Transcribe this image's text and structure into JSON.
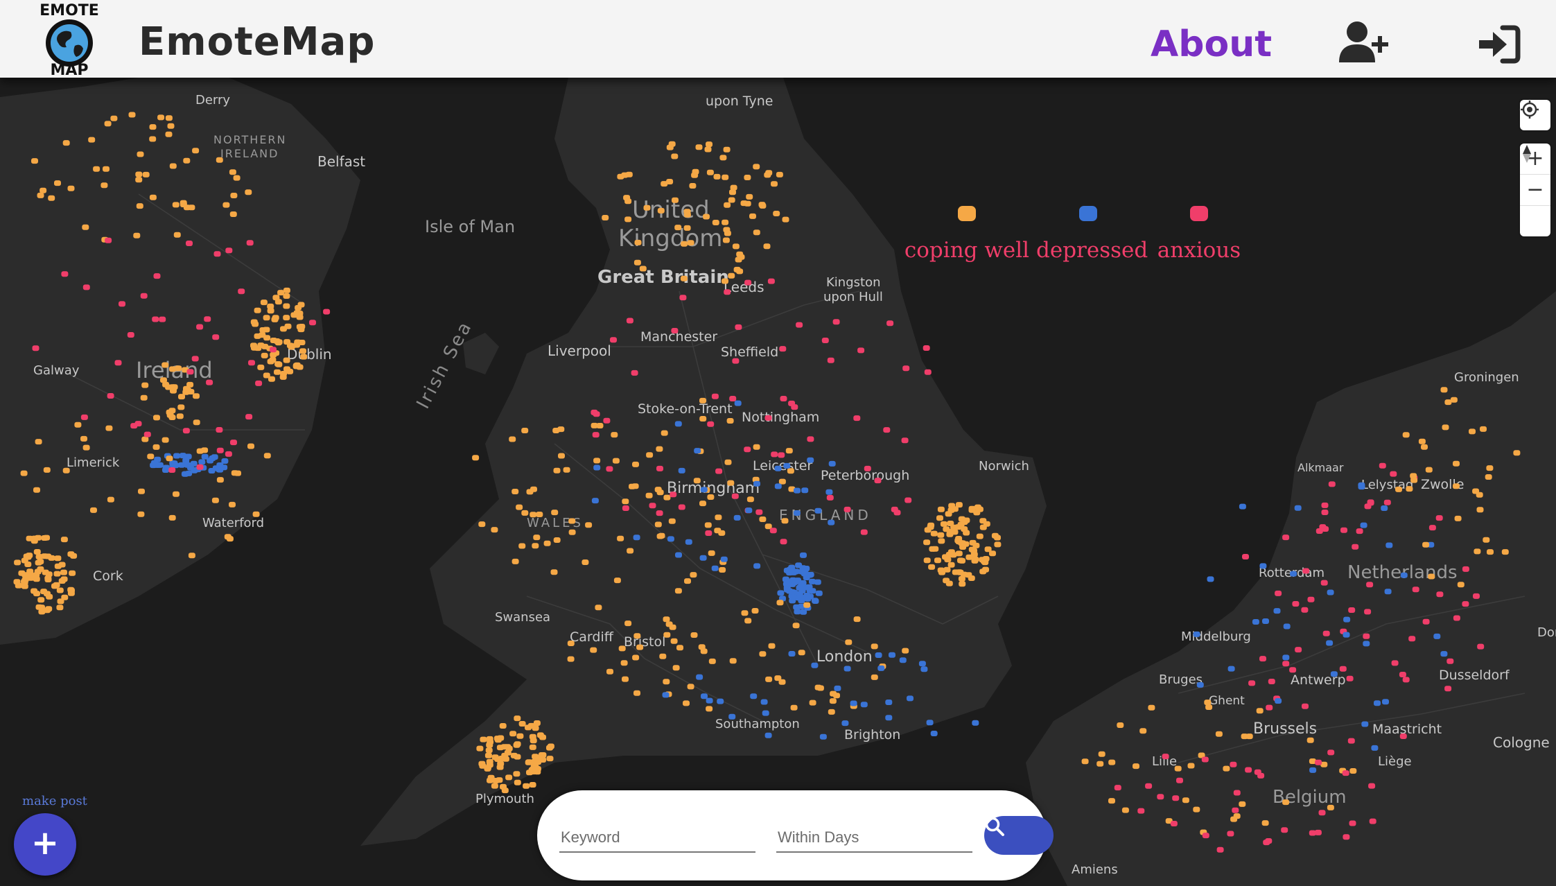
{
  "header": {
    "logo_alt": "EMOTE MAP",
    "logo_top": "EMOTE",
    "logo_bottom": "MAP",
    "brand": "EmoteMap",
    "about_label": "About",
    "signup_icon": "user-plus-icon",
    "login_icon": "sign-in-icon"
  },
  "legend": [
    {
      "label": "coping well",
      "color": "#f5a846"
    },
    {
      "label": "depressed",
      "color": "#3a74d6"
    },
    {
      "label": "anxious",
      "color": "#f03e6a"
    }
  ],
  "map_controls": {
    "locate_icon": "crosshair-icon",
    "zoom_in": "+",
    "zoom_out": "−",
    "compass_icon": "compass-icon"
  },
  "map": {
    "labels": {
      "derry": "Derry",
      "upon_tyne": "upon Tyne",
      "northern": "NORTHERN",
      "ireland_ni": "IRELAND",
      "belfast": "Belfast",
      "isle_of_man": "Isle of Man",
      "united": "United",
      "kingdom": "Kingdom",
      "great_britain": "Great Britain",
      "leeds": "Leeds",
      "kingston": "Kingston",
      "upon_hull": "upon Hull",
      "dublin": "Dublin",
      "irish_sea": "Irish Sea",
      "liverpool": "Liverpool",
      "manchester": "Manchester",
      "sheffield": "Sheffield",
      "galway": "Galway",
      "ireland": "Ireland",
      "stoke": "Stoke-on-Trent",
      "nottingham": "Nottingham",
      "limerick": "Limerick",
      "leicester": "Leicester",
      "peterborough": "Peterborough",
      "norwich": "Norwich",
      "birmingham": "Birmingham",
      "england": "ENGLAND",
      "wales": "WALES",
      "waterford": "Waterford",
      "cork": "Cork",
      "swansea": "Swansea",
      "cardiff": "Cardiff",
      "bristol": "Bristol",
      "london": "London",
      "southampton": "Southampton",
      "brighton": "Brighton",
      "plymouth": "Plymouth",
      "groningen": "Groningen",
      "alkmaar": "Alkmaar",
      "lelystad": "Lelystad",
      "zwolle": "Zwolle",
      "rotterdam": "Rotterdam",
      "netherlands": "Netherlands",
      "middelburg": "Middelburg",
      "bruges": "Bruges",
      "antwerp": "Antwerp",
      "dusseldorf": "Dusseldorf",
      "ghent": "Ghent",
      "brussels": "Brussels",
      "maastricht": "Maastricht",
      "cologne": "Cologne",
      "lille": "Lille",
      "liege": "Liège",
      "belgium": "Belgium",
      "amiens": "Amiens",
      "dor": "Dor"
    }
  },
  "make_post": {
    "label": "make post",
    "icon": "plus-icon"
  },
  "search": {
    "keyword_placeholder": "Keyword",
    "days_placeholder": "Within Days",
    "button_icon": "search-icon"
  }
}
